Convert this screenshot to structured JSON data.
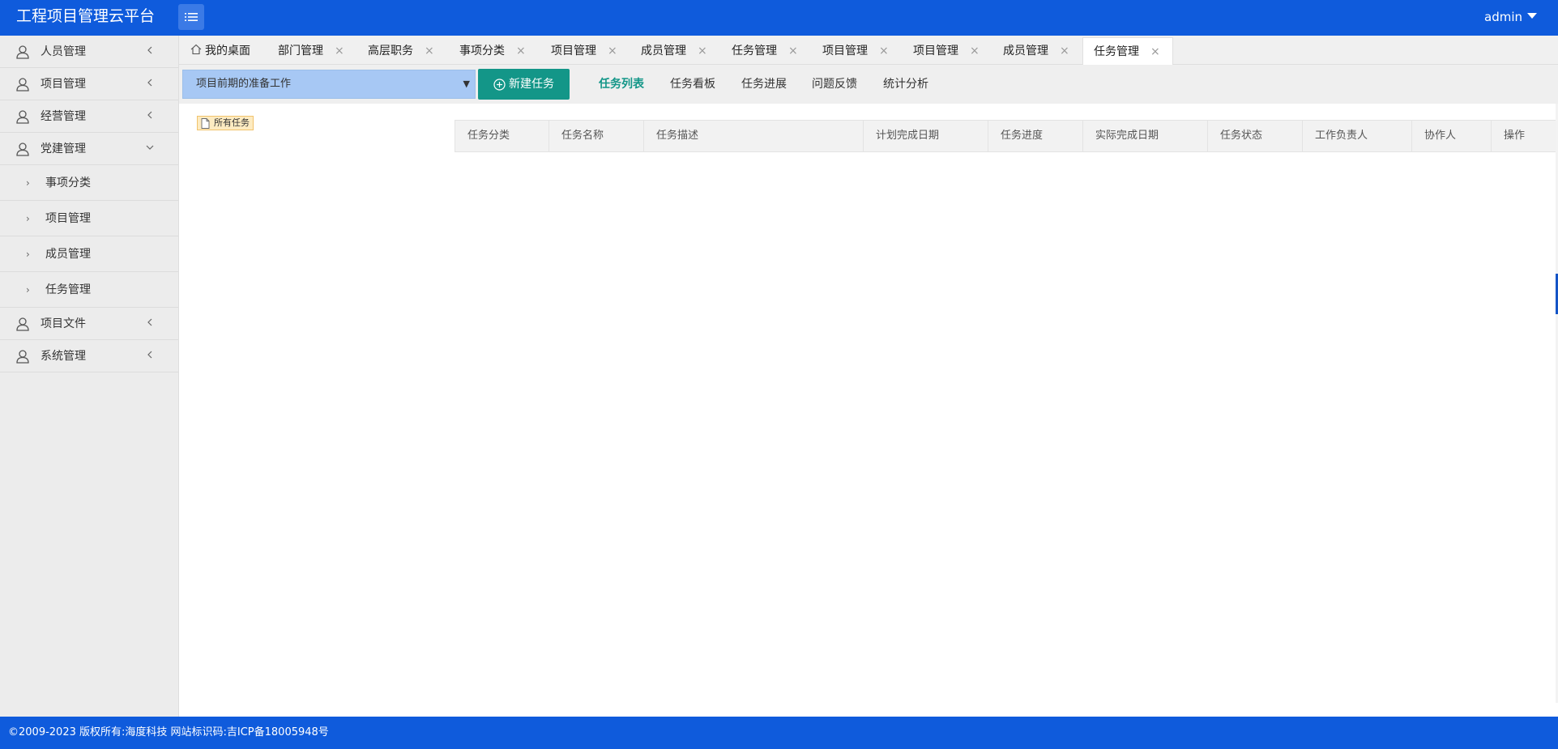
{
  "header": {
    "title": "工程项目管理云平台",
    "user": "admin"
  },
  "sidebar": {
    "items": [
      {
        "label": "人员管理",
        "icon": "user-icon",
        "state": "collapsed"
      },
      {
        "label": "项目管理",
        "icon": "user-icon",
        "state": "collapsed"
      },
      {
        "label": "经营管理",
        "icon": "user-icon",
        "state": "collapsed"
      },
      {
        "label": "党建管理",
        "icon": "user-icon",
        "state": "expanded",
        "children": [
          {
            "label": "事项分类"
          },
          {
            "label": "项目管理"
          },
          {
            "label": "成员管理"
          },
          {
            "label": "任务管理"
          }
        ]
      },
      {
        "label": "项目文件",
        "icon": "user-icon",
        "state": "collapsed"
      },
      {
        "label": "系统管理",
        "icon": "user-icon",
        "state": "collapsed"
      }
    ]
  },
  "tabs": [
    {
      "label": "我的桌面",
      "icon": "home-icon",
      "closable": false
    },
    {
      "label": "部门管理",
      "closable": true
    },
    {
      "label": "高层职务",
      "closable": true
    },
    {
      "label": "事项分类",
      "closable": true
    },
    {
      "label": "项目管理",
      "closable": true
    },
    {
      "label": "成员管理",
      "closable": true
    },
    {
      "label": "任务管理",
      "closable": true
    },
    {
      "label": "项目管理",
      "closable": true
    },
    {
      "label": "项目管理",
      "closable": true
    },
    {
      "label": "成员管理",
      "closable": true
    },
    {
      "label": "任务管理",
      "closable": true,
      "active": true
    }
  ],
  "toolbar": {
    "project_select_value": "项目前期的准备工作",
    "new_task_label": "新建任务",
    "subtabs": [
      {
        "label": "任务列表",
        "active": true
      },
      {
        "label": "任务看板"
      },
      {
        "label": "任务进展"
      },
      {
        "label": "问题反馈"
      },
      {
        "label": "统计分析"
      }
    ]
  },
  "tree": {
    "root_label": "所有任务"
  },
  "table": {
    "columns": [
      "任务分类",
      "任务名称",
      "任务描述",
      "计划完成日期",
      "任务进度",
      "实际完成日期",
      "任务状态",
      "工作负责人",
      "协作人",
      "操作"
    ],
    "rows": []
  },
  "footer": {
    "text": "©2009-2023 版权所有:海度科技 网站标识码:吉ICP备18005948号"
  },
  "colors": {
    "primary": "#0f5bdc",
    "accent_green": "#139688",
    "select_bg": "#a7c8f4"
  }
}
